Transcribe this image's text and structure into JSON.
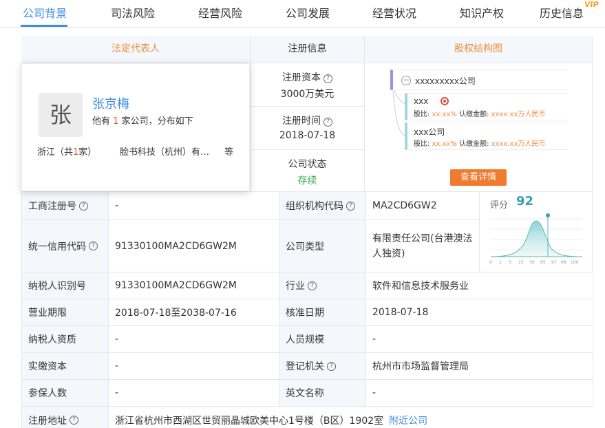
{
  "tabs": [
    {
      "label": "公司背景"
    },
    {
      "label": "司法风险"
    },
    {
      "label": "经营风险"
    },
    {
      "label": "公司发展"
    },
    {
      "label": "经营状况"
    },
    {
      "label": "知识产权"
    },
    {
      "label": "历史信息"
    }
  ],
  "vip_badge": "VIP",
  "headers": {
    "legal_rep": "法定代表人",
    "registration": "注册信息",
    "equity": "股权结构图"
  },
  "registration": {
    "capital_label": "注册资本",
    "capital_value": "3000万美元",
    "time_label": "注册时间",
    "time_value": "2018-07-18",
    "status_label": "公司状态",
    "status_value": "存续"
  },
  "legal_rep": {
    "avatar_char": "张",
    "name": "张京梅",
    "desc_prefix": "他有",
    "desc_count": "1",
    "desc_suffix": "家公司，分布如下",
    "region_prefix": "浙江（共",
    "region_count": "1",
    "region_suffix": "家）",
    "company": "脸书科技（杭州）有…",
    "more": "等"
  },
  "equity": {
    "root": "xxxxxxxxx公司",
    "nodes": [
      {
        "name": "xxx",
        "ratio_label": "股比:",
        "ratio": "xx.xx%",
        "amount_label": "认缴金额:",
        "amount": "xxxx.xx万人民币"
      },
      {
        "name": "xxx公司",
        "ratio_label": "股比:",
        "ratio": "xx.xx%",
        "amount_label": "认缴金额:",
        "amount": "xxxx.xx万人民币"
      }
    ],
    "detail_button": "查看详情"
  },
  "score": {
    "label": "评分",
    "value": "92",
    "axis": [
      "0",
      "1",
      "3",
      "15",
      "50",
      "85",
      "97",
      "99",
      "100"
    ]
  },
  "table": {
    "biz_reg_no_label": "工商注册号",
    "biz_reg_no": "-",
    "org_code_label": "组织机构代码",
    "org_code": "MA2CD6GW2",
    "credit_code_label": "统一信用代码",
    "credit_code": "91330100MA2CD6GW2M",
    "company_type_label": "公司类型",
    "company_type": "有限责任公司(台港澳法人独资)",
    "taxpayer_id_label": "纳税人识别号",
    "taxpayer_id": "91330100MA2CD6GW2M",
    "industry_label": "行业",
    "industry": "软件和信息技术服务业",
    "term_label": "营业期限",
    "term": "2018-07-18至2038-07-16",
    "approve_label": "核准日期",
    "approve": "2018-07-18",
    "taxpayer_qual_label": "纳税人资质",
    "taxpayer_qual": "-",
    "staff_label": "人员规模",
    "staff": "-",
    "paid_capital_label": "实缴资本",
    "paid_capital": "-",
    "authority_label": "登记机关",
    "authority": "杭州市市场监督管理局",
    "insured_label": "参保人数",
    "insured": "-",
    "english_label": "英文名称",
    "english": "-",
    "address_label": "注册地址",
    "address": "浙江省杭州市西湖区世贸丽晶城欧美中心1号楼（B区）1902室",
    "nearby_link": "附近公司"
  }
}
